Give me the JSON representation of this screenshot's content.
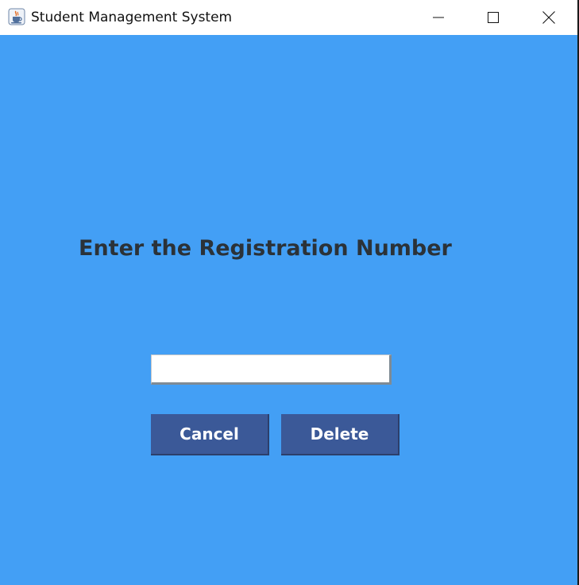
{
  "window": {
    "title": "Student Management System",
    "icon": "java-coffee-cup-icon",
    "controls": {
      "minimize": "minimize-icon",
      "maximize": "maximize-icon",
      "close": "close-icon"
    }
  },
  "form": {
    "heading": "Enter the Registration Number",
    "registration_value": "",
    "cancel_label": "Cancel",
    "delete_label": "Delete"
  },
  "colors": {
    "background": "#439ff5",
    "button": "#3b5998",
    "heading_text": "#2b3238",
    "button_text": "#ffffff"
  }
}
